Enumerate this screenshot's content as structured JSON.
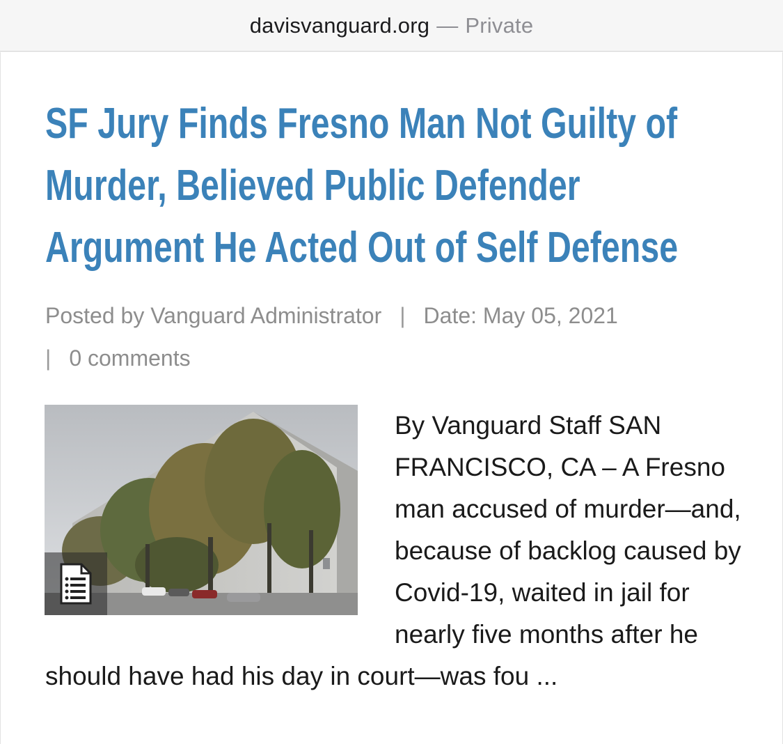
{
  "browser": {
    "domain": "davisvanguard.org",
    "separator": "—",
    "mode": "Private"
  },
  "article": {
    "title": "SF Jury Finds Fresno Man Not Guilty of Murder, Believed Public Defender Argument He Acted Out of Self Defense",
    "meta": {
      "posted_by": "Posted by Vanguard Administrator",
      "divider": "|",
      "date": "Date: May 05, 2021",
      "comments": "0 comments"
    },
    "image": {
      "icon": "document-list-icon"
    },
    "excerpt": "By Vanguard Staff SAN FRANCISCO, CA – A Fresno man accused of murder—and, because of backlog caused by Covid-19, waited in jail for nearly five months after he should have had his day in court—was fou ..."
  }
}
